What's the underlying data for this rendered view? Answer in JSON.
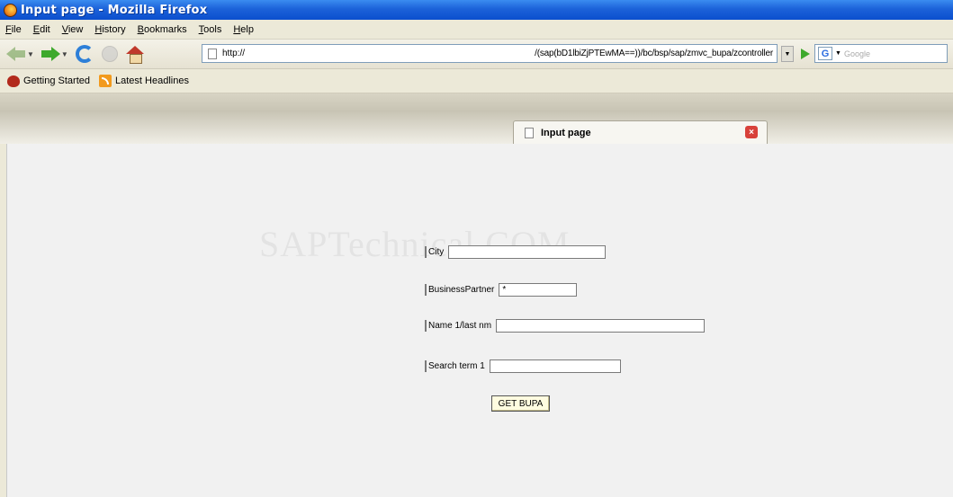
{
  "window": {
    "title": "Input page - Mozilla Firefox"
  },
  "menubar": {
    "items": [
      "File",
      "Edit",
      "View",
      "History",
      "Bookmarks",
      "Tools",
      "Help"
    ]
  },
  "navbar": {
    "url_left": "http://",
    "url_right": "/(sap(bD1lbiZjPTEwMA==))/bc/bsp/sap/zmvc_bupa/zcontroller",
    "search_placeholder": "Google",
    "search_engine_letter": "G"
  },
  "bookmarks": [
    {
      "label": "Getting Started",
      "icon": "getting-started-icon"
    },
    {
      "label": "Latest Headlines",
      "icon": "rss-icon"
    }
  ],
  "tab": {
    "title": "Input page"
  },
  "watermark": "SAPTechnical.COM",
  "form": {
    "city_label": "City",
    "city_value": "",
    "bp_label": "BusinessPartner",
    "bp_value": "*",
    "name_label": "Name 1/last nm",
    "name_value": "",
    "search_label": "Search term 1",
    "search_value": "",
    "submit_label": "GET BUPA"
  }
}
